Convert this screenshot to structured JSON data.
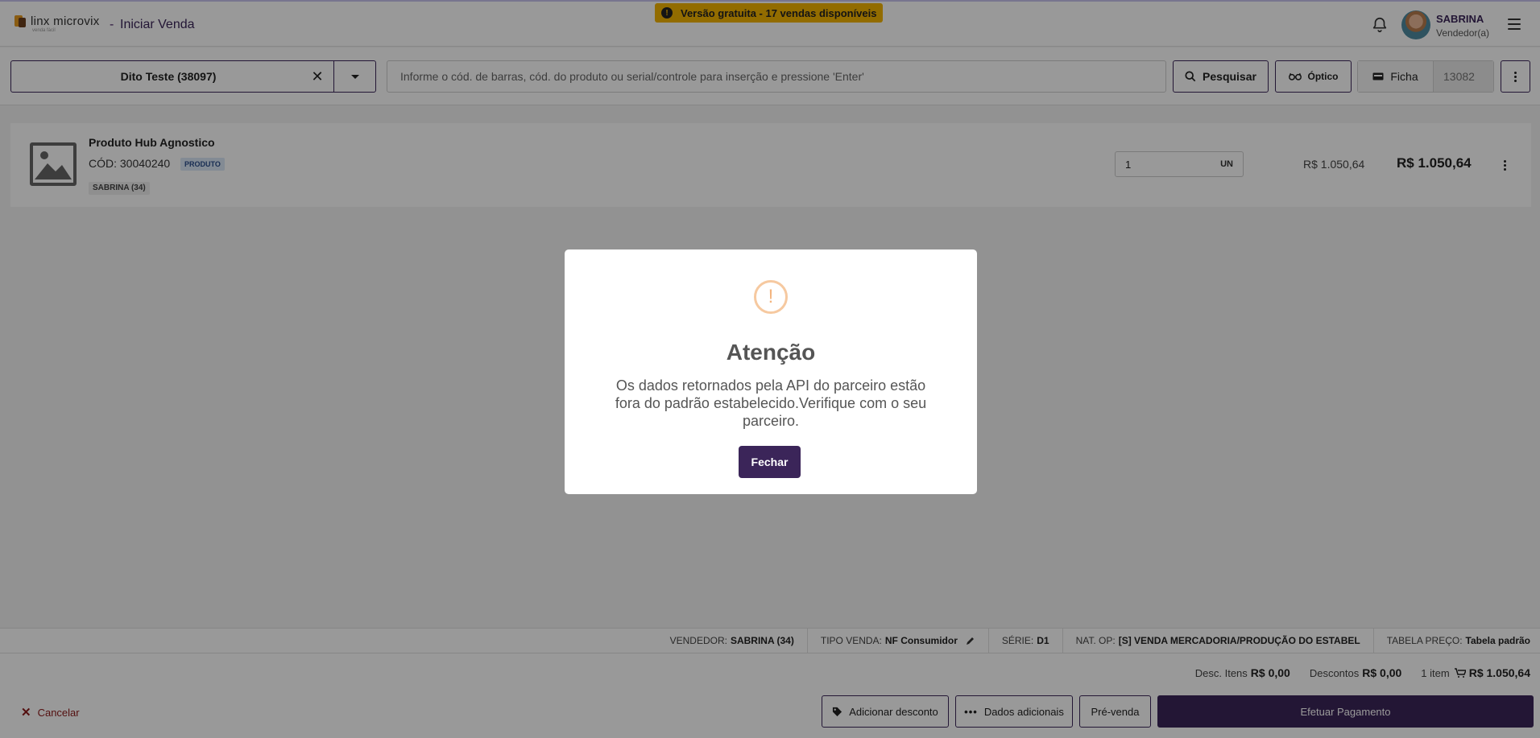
{
  "header": {
    "logo_text": "linx microvix",
    "logo_sub": "venda fácil",
    "separator": "-",
    "title": "Iniciar Venda",
    "banner": "Versão gratuita - 17 vendas disponíveis",
    "user_name": "SABRINA",
    "user_role": "Vendedor(a)"
  },
  "toolbar": {
    "client": "Dito Teste (38097)",
    "search_placeholder": "Informe o cód. de barras, cód. do produto ou serial/controle para inserção e pressione 'Enter'",
    "pesquisar": "Pesquisar",
    "optico": "Óptico",
    "ficha": "Ficha",
    "ficha_placeholder": "13082"
  },
  "product": {
    "name": "Produto Hub Agnostico",
    "code": "CÓD: 30040240",
    "badge": "PRODUTO",
    "seller": "SABRINA (34)",
    "quantity": "1",
    "unit": "UN",
    "unit_price": "R$ 1.050,64",
    "total_price": "R$ 1.050,64"
  },
  "info_bar": {
    "vendedor_label": "VENDEDOR:",
    "vendedor_value": "SABRINA (34)",
    "tipo_label": "TIPO VENDA:",
    "tipo_value": "NF Consumidor",
    "serie_label": "SÉRIE:",
    "serie_value": "D1",
    "natop_label": "NAT. OP:",
    "natop_value": "[S] VENDA MERCADORIA/PRODUÇÃO DO ESTABEL",
    "tabela_label": "TABELA PREÇO:",
    "tabela_value": "Tabela padrão"
  },
  "summary": {
    "desc_itens_label": "Desc. Itens",
    "desc_itens_value": "R$ 0,00",
    "descontos_label": "Descontos",
    "descontos_value": "R$ 0,00",
    "items_count": "1 item",
    "total": "R$ 1.050,64"
  },
  "footer": {
    "cancel": "Cancelar",
    "add_discount": "Adicionar desconto",
    "additional_data": "Dados adicionais",
    "pre_sale": "Pré-venda",
    "pay": "Efetuar Pagamento"
  },
  "modal": {
    "icon": "!",
    "title": "Atenção",
    "message": "Os dados retornados pela API do parceiro estão fora do padrão estabelecido.Verifique com o seu parceiro.",
    "close": "Fechar"
  },
  "colors": {
    "primary": "#3b2559",
    "banner": "#f4b400",
    "warning_icon": "#f3b47e",
    "cancel": "#8b1a1a"
  }
}
